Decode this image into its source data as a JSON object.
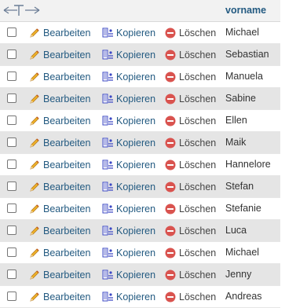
{
  "header": {
    "column_label": "vorname",
    "sort_icon": "sort-arrows-icon"
  },
  "actions": {
    "edit_label": "Bearbeiten",
    "copy_label": "Kopieren",
    "delete_label": "Löschen"
  },
  "rows": [
    {
      "vorname": "Michael"
    },
    {
      "vorname": "Sebastian"
    },
    {
      "vorname": "Manuela"
    },
    {
      "vorname": "Sabine"
    },
    {
      "vorname": "Ellen"
    },
    {
      "vorname": "Maik"
    },
    {
      "vorname": "Hannelore"
    },
    {
      "vorname": "Stefan"
    },
    {
      "vorname": "Stefanie"
    },
    {
      "vorname": "Luca"
    },
    {
      "vorname": "Michael"
    },
    {
      "vorname": "Jenny"
    },
    {
      "vorname": "Andreas"
    }
  ],
  "colors": {
    "link": "#235a81",
    "row_alt": "#e5e5e5",
    "delete_icon": "#d9534f"
  }
}
